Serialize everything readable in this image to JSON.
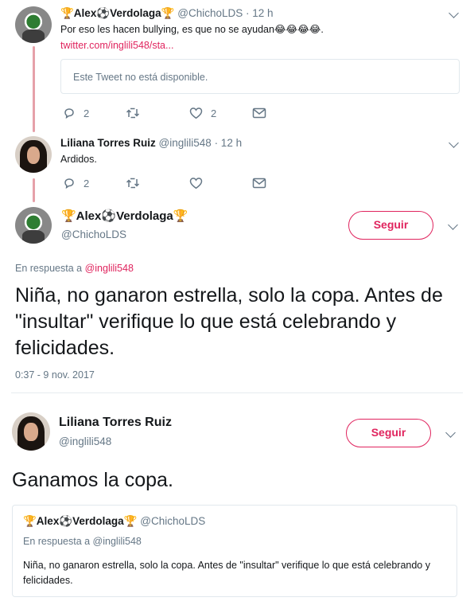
{
  "tweet1": {
    "name_pre": "🏆Alex",
    "name_ball": "⚽",
    "name_post": "Verdolaga🏆",
    "handle": "@ChichoLDS",
    "time": "· 12 h",
    "text": "Por eso les hacen bullying, es que no se ayudan😂😂😂😂.",
    "link": "twitter.com/inglili548/sta...",
    "unavailable": "Este Tweet no está disponible.",
    "replies": "2",
    "likes": "2"
  },
  "tweet2": {
    "name": "Liliana Torres Ruiz",
    "handle": "@inglili548",
    "time": "· 12 h",
    "text": "Ardidos.",
    "replies": "2"
  },
  "main": {
    "name_pre": "🏆Alex",
    "name_ball": "⚽",
    "name_post": "Verdolaga🏆",
    "handle": "@ChichoLDS",
    "follow": "Seguir",
    "reply_prefix": "En respuesta a",
    "reply_to": "@inglili548",
    "text": "Niña, no ganaron estrella, solo la copa. Antes de \"insultar\" verifique lo que está celebrando y felicidades.",
    "timestamp": "0:37 - 9 nov. 2017"
  },
  "second": {
    "name": "Liliana Torres Ruiz",
    "handle": "@inglili548",
    "follow": "Seguir",
    "text": "Ganamos la copa."
  },
  "quote": {
    "name_pre": "🏆Alex",
    "name_ball": "⚽",
    "name_post": "Verdolaga🏆",
    "handle": "@ChichoLDS",
    "reply_line": "En respuesta a @inglili548",
    "text": "Niña, no ganaron estrella, solo la copa. Antes de \"insultar\" verifique lo que está celebrando y felicidades."
  },
  "icons": [
    "reply-icon",
    "retweet-icon",
    "like-icon",
    "dm-icon",
    "chevron-down-icon"
  ],
  "colors": {
    "accent": "#e0245e",
    "gray": "#657786",
    "thread": "#e6a1a9"
  }
}
